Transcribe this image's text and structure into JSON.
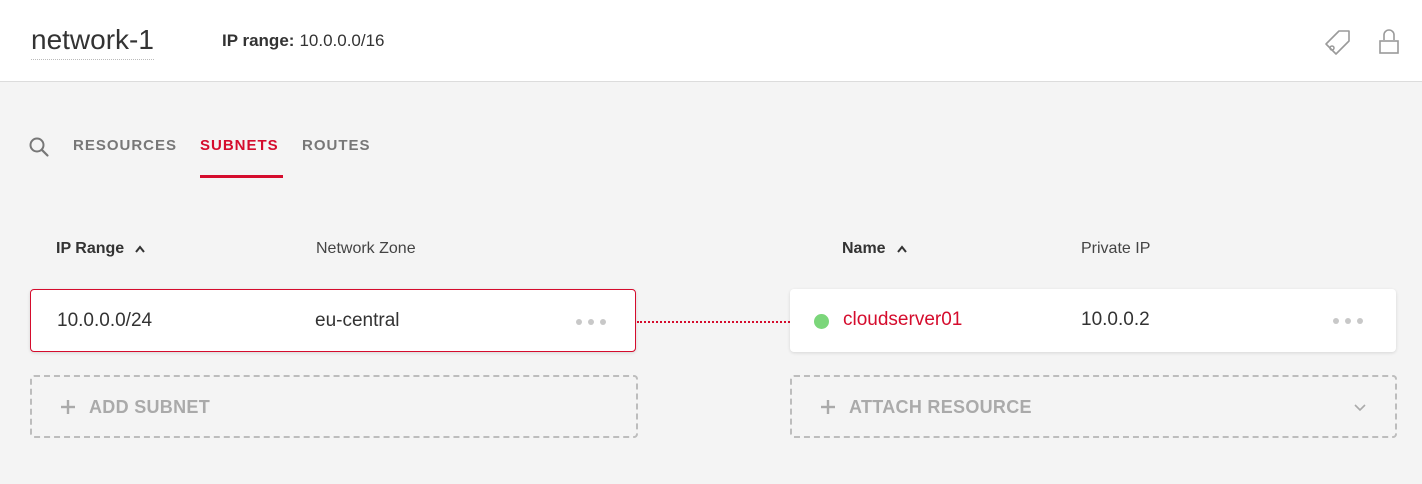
{
  "header": {
    "network_name": "network-1",
    "ip_range_label": "IP range:",
    "ip_range_value": "10.0.0.0/16"
  },
  "tabs": [
    {
      "label": "RESOURCES",
      "active": false
    },
    {
      "label": "SUBNETS",
      "active": true
    },
    {
      "label": "ROUTES",
      "active": false
    }
  ],
  "subnets_table": {
    "headers": {
      "ip_range": "IP Range",
      "network_zone": "Network Zone"
    },
    "rows": [
      {
        "ip_range": "10.0.0.0/24",
        "network_zone": "eu-central"
      }
    ],
    "add_label": "ADD SUBNET"
  },
  "resources_table": {
    "headers": {
      "name": "Name",
      "private_ip": "Private IP"
    },
    "rows": [
      {
        "name": "cloudserver01",
        "private_ip": "10.0.0.2",
        "status": "running"
      }
    ],
    "attach_label": "ATTACH RESOURCE"
  },
  "colors": {
    "accent": "#d50c2d",
    "status_running": "#7bd67a",
    "muted": "#aaaaaa"
  },
  "icons": [
    "tag-icon",
    "lock-icon",
    "search-icon",
    "sort-up-icon",
    "more-icon",
    "plus-icon",
    "chevron-down-icon"
  ]
}
